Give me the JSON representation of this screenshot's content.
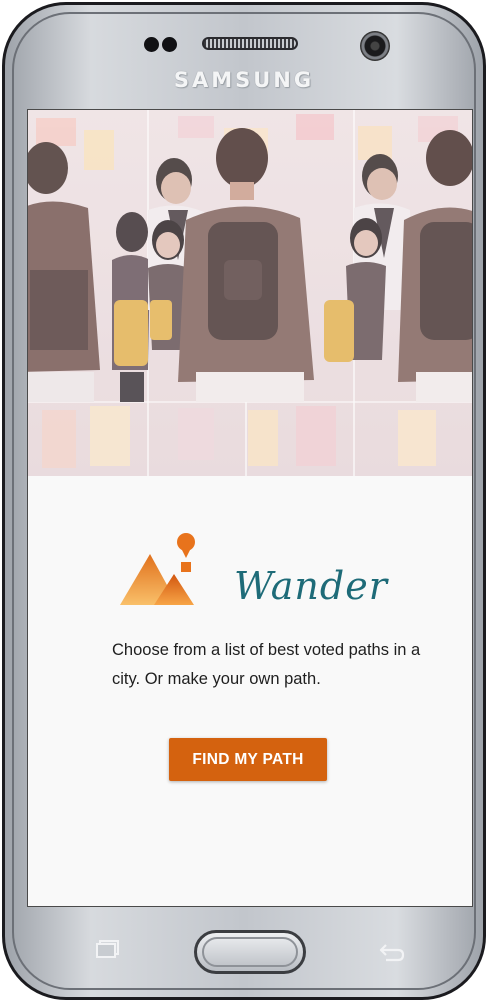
{
  "device": {
    "brand": "SAMSUNG"
  },
  "app": {
    "name": "Wander",
    "description": "Choose from a list of best voted paths in a city. Or make your own path.",
    "cta_label": "FIND MY PATH",
    "hero_image": "crowd-street-photo",
    "logo_icon": "mountain-pin-icon"
  },
  "nav": {
    "recents_icon": "recents-icon",
    "home_icon": "home-button",
    "back_icon": "back-icon"
  },
  "colors": {
    "accent": "#d4620f",
    "title": "#1e6b78",
    "logo_orange": "#f3a044",
    "screen_bg": "#f9f9f9"
  }
}
